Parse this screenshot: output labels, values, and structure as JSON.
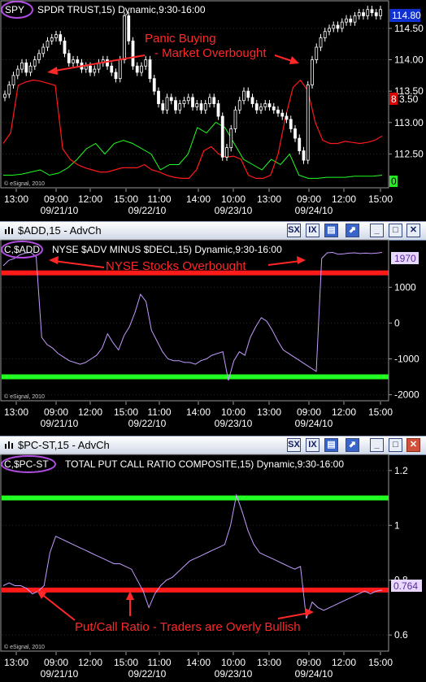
{
  "colors": {
    "price": "#ffffff",
    "red": "#ff1a1a",
    "green": "#22ff22",
    "violet": "#c49cff",
    "annot": "#ff2828",
    "circle": "#b04de0"
  },
  "panels": [
    {
      "id": "spy",
      "window_title": "",
      "symbol_circle": "SPY",
      "title_text": "SPDR TRUST,15) Dynamic,9:30-16:00",
      "copyright": "© eSignal, 2010",
      "y_ticks": [
        "114.50",
        "114.00",
        "113.50",
        "113.00",
        "112.50"
      ],
      "last_value": "114.80",
      "red_axis_marker": "8",
      "green_axis_marker": "0",
      "annotation_lines": [
        "Panic Buying",
        "- Market Overbought"
      ]
    },
    {
      "id": "add",
      "window_title": "$ADD,15 - AdvCh",
      "symbol_circle": "C,$ADD",
      "title_text": "NYSE $ADV MINUS $DECL,15) Dynamic,9:30-16:00",
      "copyright": "© eSignal, 2010",
      "y_ticks": [
        "1000",
        "0",
        "-1000",
        "-2000"
      ],
      "last_value": "1970",
      "annotation_lines": [
        "NYSE Stocks Overbought"
      ]
    },
    {
      "id": "pcst",
      "window_title": "$PC-ST,15 - AdvCh",
      "symbol_circle": "C,$PC-ST",
      "title_text": "TOTAL PUT CALL RATIO COMPOSITE,15) Dynamic,9:30-16:00",
      "copyright": "© eSignal, 2010",
      "y_ticks": [
        "1.2",
        "1",
        "0.8",
        "0.6"
      ],
      "last_value": "0.764",
      "annotation_lines": [
        "Put/Call Ratio - Traders are Overly Bullish"
      ]
    }
  ],
  "x_axis": {
    "times": [
      "13:00",
      "09:00",
      "12:00",
      "15:00",
      "11:00",
      "14:00",
      "10:00",
      "13:00",
      "09:00",
      "12:00",
      "15:00"
    ],
    "dates": [
      "09/21/10",
      "09/22/10",
      "09/23/10",
      "09/24/10"
    ]
  },
  "window_buttons": {
    "sx": "SX",
    "ix": "IX"
  },
  "chart_data": [
    {
      "type": "line",
      "title": "SPDR TRUST,15) Dynamic,9:30-16:00",
      "note": "candlestick price series (close approximations) with two oscillator lines",
      "ylim": [
        112.0,
        114.9
      ],
      "series": [
        {
          "name": "close",
          "values": [
            113.45,
            113.6,
            113.75,
            113.85,
            113.95,
            113.8,
            113.9,
            114.0,
            114.1,
            114.2,
            114.3,
            114.35,
            114.4,
            114.3,
            114.1,
            113.95,
            114.0,
            113.95,
            113.85,
            113.9,
            113.8,
            113.85,
            113.95,
            114.0,
            113.9,
            113.8,
            113.7,
            114.0,
            114.7,
            114.3,
            113.9,
            113.8,
            113.9,
            114.0,
            113.7,
            113.5,
            113.3,
            113.2,
            113.4,
            113.35,
            113.2,
            113.3,
            113.35,
            113.4,
            113.25,
            113.3,
            113.2,
            113.3,
            113.4,
            113.3,
            113.1,
            112.45,
            112.6,
            112.9,
            113.2,
            113.35,
            113.5,
            113.4,
            113.3,
            113.2,
            113.25,
            113.3,
            113.25,
            113.2,
            113.15,
            113.1,
            113.05,
            112.9,
            112.75,
            112.55,
            112.4,
            113.6,
            114.0,
            114.2,
            114.35,
            114.45,
            114.5,
            114.55,
            114.5,
            114.6,
            114.65,
            114.6,
            114.7,
            114.75,
            114.7,
            114.8,
            114.75,
            114.7,
            114.8
          ]
        },
        {
          "name": "red",
          "values": [
            0.35,
            0.45,
            0.9,
            0.93,
            0.95,
            0.94,
            0.92,
            0.9,
            0.3,
            0.2,
            0.15,
            0.12,
            0.1,
            0.08,
            0.08,
            0.1,
            0.12,
            0.12,
            0.12,
            0.15,
            0.1,
            0.08,
            0.05,
            0.03,
            0.02,
            0.02,
            0.1,
            0.28,
            0.32,
            0.25,
            0.22,
            0.23,
            0.2,
            0.05,
            0.02,
            0.02,
            0.05,
            0.25,
            0.6,
            0.88,
            0.95,
            0.85,
            0.55,
            0.38,
            0.35,
            0.35,
            0.37,
            0.36,
            0.35,
            0.36,
            0.38,
            0.42
          ]
        },
        {
          "name": "green",
          "values": [
            0.05,
            0.05,
            0.06,
            0.08,
            0.1,
            0.05,
            0.07,
            0.12,
            0.2,
            0.3,
            0.35,
            0.25,
            0.35,
            0.38,
            0.35,
            0.3,
            0.25,
            0.1,
            0.15,
            0.15,
            0.25,
            0.5,
            0.45,
            0.55,
            0.5,
            0.35,
            0.2,
            0.15,
            0.1,
            0.2,
            0.15,
            0.25,
            0.05,
            0.02,
            0.02,
            0.03,
            0.03,
            0.03,
            0.04,
            0.04,
            0.04,
            0.05
          ]
        }
      ]
    },
    {
      "type": "line",
      "title": "NYSE $ADV MINUS $DECL,15) Dynamic,9:30-16:00",
      "ylim": [
        -2100,
        2300
      ],
      "reference_lines": [
        1400,
        -1500
      ],
      "series": [
        {
          "name": "$ADD",
          "values": [
            1600,
            1750,
            1800,
            1900,
            1950,
            1970,
            1850,
            -400,
            -600,
            -700,
            -850,
            -950,
            -1050,
            -1100,
            -1150,
            -1100,
            -1000,
            -900,
            -700,
            -300,
            -550,
            -750,
            -350,
            -100,
            300,
            800,
            600,
            -200,
            -500,
            -800,
            -1000,
            -1050,
            -1050,
            -1100,
            -1100,
            -1150,
            -1050,
            -1000,
            -900,
            -850,
            -800,
            -1600,
            -1050,
            -800,
            -900,
            -400,
            -100,
            150,
            50,
            -200,
            -500,
            -750,
            -850,
            -950,
            -1050,
            -1150,
            -1250,
            -1350,
            1800,
            1960,
            1970,
            1920,
            1930,
            1950,
            1960,
            1940,
            1950,
            1940,
            1950,
            1970
          ]
        }
      ]
    },
    {
      "type": "line",
      "title": "TOTAL PUT CALL RATIO COMPOSITE,15) Dynamic,9:30-16:00",
      "ylim": [
        0.55,
        1.25
      ],
      "reference_lines": [
        1.1,
        0.764
      ],
      "series": [
        {
          "name": "$PC-ST",
          "values": [
            0.78,
            0.79,
            0.78,
            0.78,
            0.77,
            0.75,
            0.76,
            0.78,
            0.9,
            0.96,
            0.95,
            0.94,
            0.93,
            0.92,
            0.91,
            0.9,
            0.89,
            0.88,
            0.87,
            0.86,
            0.86,
            0.85,
            0.84,
            0.8,
            0.76,
            0.7,
            0.75,
            0.78,
            0.8,
            0.81,
            0.83,
            0.85,
            0.87,
            0.88,
            0.89,
            0.9,
            0.91,
            0.92,
            0.93,
            1.0,
            1.11,
            1.05,
            0.98,
            0.93,
            0.9,
            0.89,
            0.88,
            0.87,
            0.86,
            0.85,
            0.84,
            0.85,
            0.66,
            0.72,
            0.7,
            0.69,
            0.7,
            0.71,
            0.72,
            0.73,
            0.74,
            0.75,
            0.76,
            0.75,
            0.76,
            0.764
          ]
        }
      ]
    }
  ]
}
